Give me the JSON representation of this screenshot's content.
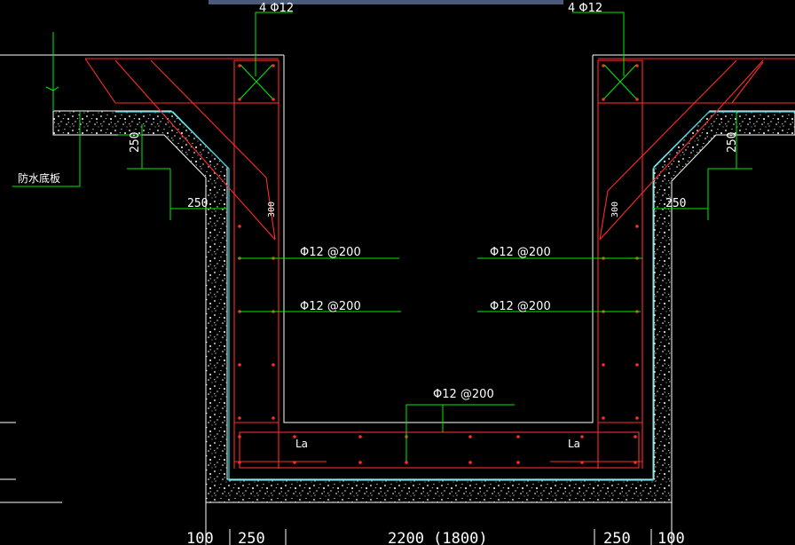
{
  "labels": {
    "top_left_bars": "4 Φ12",
    "top_right_bars": "4 Φ12",
    "waterproof_slab": "防水底板",
    "dim_left_250a": "250",
    "dim_left_250b": "250",
    "dim_right_250a": "250",
    "dim_right_250b": "250",
    "dim_left_300": "300",
    "dim_right_300": "300",
    "left_bar_1": "Φ12 @200",
    "left_bar_2": "Φ12 @200",
    "right_bar_1": "Φ12 @200",
    "right_bar_2": "Φ12 @200",
    "bottom_bar": "Φ12 @200",
    "lap_left": "La",
    "lap_right": "La"
  },
  "bottom_dims": [
    "100",
    "250",
    "2200 (1800)",
    "250",
    "100"
  ],
  "colors": {
    "background": "#000000",
    "concrete_outline": "#ffffff",
    "rebar": "#ff2a2a",
    "leader": "#00ee00",
    "waterproof": "#33dddd",
    "text": "#ffffff",
    "title_bar": "#4a5a7a"
  }
}
